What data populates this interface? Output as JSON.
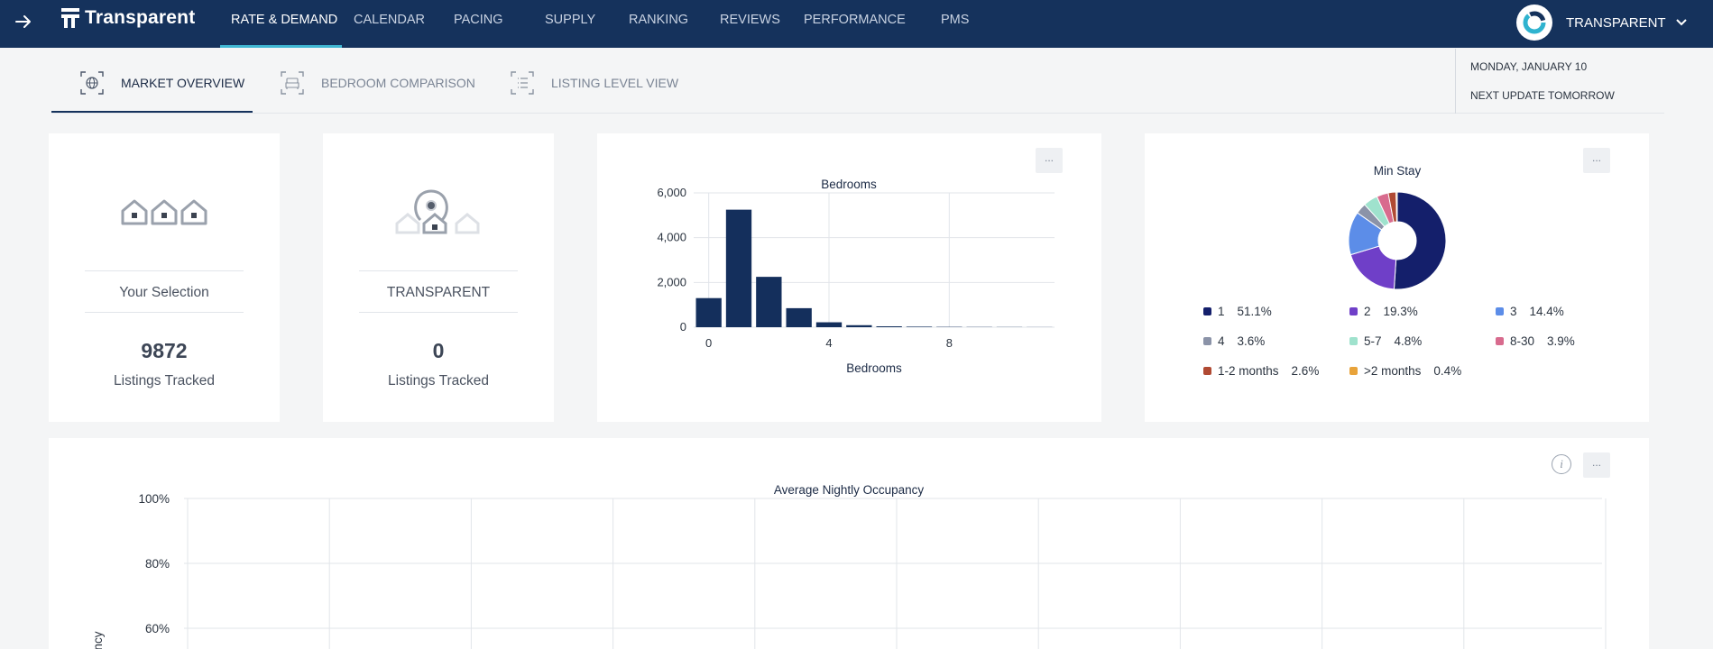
{
  "app": {
    "brand_name": "Transparent",
    "account_name": "TRANSPARENT"
  },
  "nav": {
    "items": [
      {
        "label": "RATE & DEMAND",
        "active": true
      },
      {
        "label": "CALENDAR"
      },
      {
        "label": "PACING"
      },
      {
        "label": "SUPPLY"
      },
      {
        "label": "RANKING"
      },
      {
        "label": "REVIEWS"
      },
      {
        "label": "PERFORMANCE"
      },
      {
        "label": "PMS"
      }
    ]
  },
  "subtabs": [
    {
      "label": "MARKET OVERVIEW",
      "icon": "globe-icon",
      "active": true
    },
    {
      "label": "BEDROOM COMPARISON",
      "icon": "bed-icon"
    },
    {
      "label": "LISTING LEVEL VIEW",
      "icon": "list-icon"
    }
  ],
  "status": {
    "date": "MONDAY, JANUARY 10",
    "next_update": "NEXT UPDATE TOMORROW"
  },
  "cards": {
    "selection": {
      "label": "Your Selection",
      "value": "9872",
      "sub": "Listings Tracked"
    },
    "company": {
      "label": "TRANSPARENT",
      "value": "0",
      "sub": "Listings Tracked"
    }
  },
  "more_label": "...",
  "info_label": "i",
  "colors": {
    "nav_bg": "#15325c",
    "accent": "#3fb7d3",
    "bar": "#142f5c"
  },
  "chart_data": [
    {
      "type": "bar",
      "title": "Bedrooms",
      "xlabel": "Bedrooms",
      "ylabel": "",
      "x": [
        0,
        1,
        2,
        3,
        4,
        5,
        6,
        7,
        8,
        9,
        10,
        11
      ],
      "values": [
        1300,
        5250,
        2250,
        850,
        220,
        90,
        40,
        25,
        15,
        10,
        8,
        5
      ],
      "xticks": [
        "0",
        "4",
        "8"
      ],
      "yticks": [
        "0",
        "2,000",
        "4,000",
        "6,000"
      ],
      "ylim": [
        0,
        6000
      ],
      "grid": true
    },
    {
      "type": "pie",
      "title": "Min Stay",
      "donut": true,
      "slices": [
        {
          "label": "1",
          "pct": "51.1%",
          "value": 51.1,
          "color": "#141f6b"
        },
        {
          "label": "2",
          "pct": "19.3%",
          "value": 19.3,
          "color": "#6f3fc8"
        },
        {
          "label": "3",
          "pct": "14.4%",
          "value": 14.4,
          "color": "#5c8de8"
        },
        {
          "label": "4",
          "pct": "3.6%",
          "value": 3.6,
          "color": "#8b93a8"
        },
        {
          "label": "5-7",
          "pct": "4.8%",
          "value": 4.8,
          "color": "#9fe2cd"
        },
        {
          "label": "8-30",
          "pct": "3.9%",
          "value": 3.9,
          "color": "#d86b8e"
        },
        {
          "label": "1-2 months",
          "pct": "2.6%",
          "value": 2.6,
          "color": "#b04a33"
        },
        {
          "label": ">2 months",
          "pct": "0.4%",
          "value": 0.4,
          "color": "#e8a33a"
        }
      ]
    },
    {
      "type": "line",
      "title": "Average Nightly Occupancy",
      "ylabel": "ncy",
      "yticks": [
        "60%",
        "80%",
        "100%"
      ],
      "ylim": [
        0,
        100
      ],
      "series": [],
      "grid": true
    }
  ]
}
